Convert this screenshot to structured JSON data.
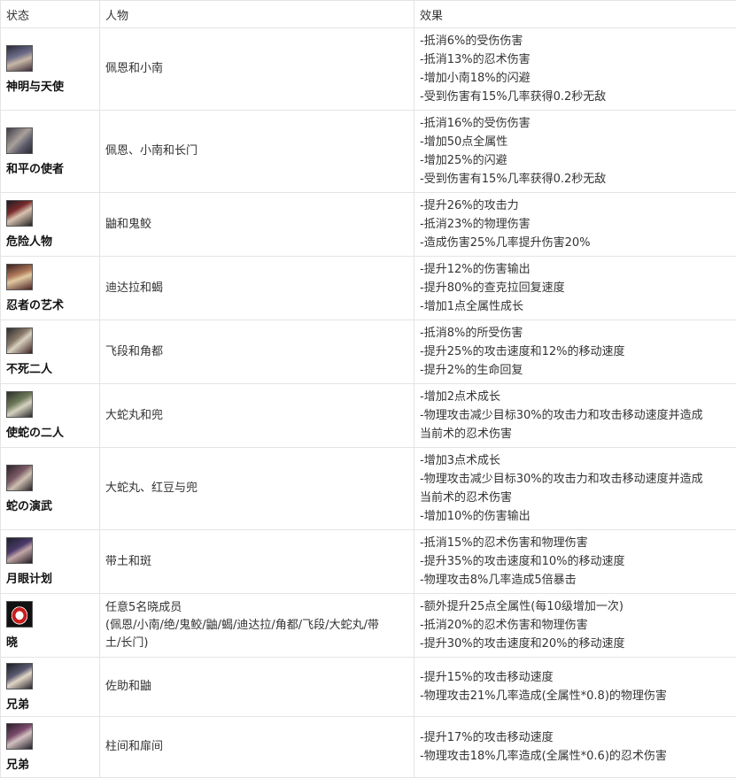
{
  "headers": {
    "status": "状态",
    "characters": "人物",
    "effects": "效果"
  },
  "rows": [
    {
      "status": "神明与天使",
      "icon": "pein-konan-portrait-icon",
      "characters": "佩恩和小南",
      "effects": [
        "-抵消6%的受伤伤害",
        "-抵消13%的忍术伤害",
        "-增加小南18%的闪避",
        "-受到伤害有15%几率获得0.2秒无敌"
      ]
    },
    {
      "status": "和平の使者",
      "icon": "pein-konan-nagato-portrait-icon",
      "characters": "佩恩、小南和长门",
      "effects": [
        "-抵消16%的受伤伤害",
        "-增加50点全属性",
        "-增加25%的闪避",
        "-受到伤害有15%几率获得0.2秒无敌"
      ]
    },
    {
      "status": "危险人物",
      "icon": "itachi-kisame-portrait-icon",
      "characters": "鼬和鬼鲛",
      "effects": [
        "-提升26%的攻击力",
        "-抵消23%的物理伤害",
        "-造成伤害25%几率提升伤害20%"
      ]
    },
    {
      "status": "忍者の艺术",
      "icon": "deidara-sasori-portrait-icon",
      "characters": "迪达拉和蝎",
      "effects": [
        "-提升12%的伤害输出",
        "-提升80%的查克拉回复速度",
        "-增加1点全属性成长"
      ]
    },
    {
      "status": "不死二人",
      "icon": "hidan-kakuzu-portrait-icon",
      "characters": "飞段和角都",
      "effects": [
        "-抵消8%的所受伤害",
        "-提升25%的攻击速度和12%的移动速度",
        "-提升2%的生命回复"
      ]
    },
    {
      "status": "使蛇の二人",
      "icon": "orochimaru-kabuto-portrait-icon",
      "characters": "大蛇丸和兜",
      "effects": [
        "-增加2点术成长",
        "-物理攻击减少目标30%的攻击力和攻击移动速度并造成",
        "当前术的忍术伤害"
      ]
    },
    {
      "status": "蛇の演武",
      "icon": "orochimaru-anko-kabuto-portrait-icon",
      "characters": "大蛇丸、红豆与兜",
      "effects": [
        "-增加3点术成长",
        "-物理攻击减少目标30%的攻击力和攻击移动速度并造成",
        "当前术的忍术伤害",
        "-增加10%的伤害输出"
      ]
    },
    {
      "status": "月眼计划",
      "icon": "obito-madara-portrait-icon",
      "characters": "带土和斑",
      "effects": [
        "-抵消15%的忍术伤害和物理伤害",
        "-提升35%的攻击速度和10%的移动速度",
        "-物理攻击8%几率造成5倍暴击"
      ]
    },
    {
      "status": "晓",
      "icon": "akatsuki-red-cloud-icon",
      "characters": "任意5名晓成员\n(佩恩/小南/绝/鬼鲛/鼬/蝎/迪达拉/角都/飞段/大蛇丸/带\n土/长门)",
      "effects": [
        "-额外提升25点全属性(每10级增加一次)",
        "-抵消20%的忍术伤害和物理伤害",
        "-提升30%的攻击速度和20%的移动速度"
      ]
    },
    {
      "status": "兄弟",
      "icon": "sasuke-itachi-portrait-icon",
      "characters": "佐助和鼬",
      "effects": [
        "-提升15%的攻击移动速度",
        "-物理攻击21%几率造成(全属性*0.8)的物理伤害"
      ]
    },
    {
      "status": "兄弟",
      "icon": "hashirama-tobirama-portrait-icon",
      "characters": "柱间和扉间",
      "effects": [
        "-提升17%的攻击移动速度",
        "-物理攻击18%几率造成(全属性*0.6)的忍术伤害"
      ]
    }
  ]
}
